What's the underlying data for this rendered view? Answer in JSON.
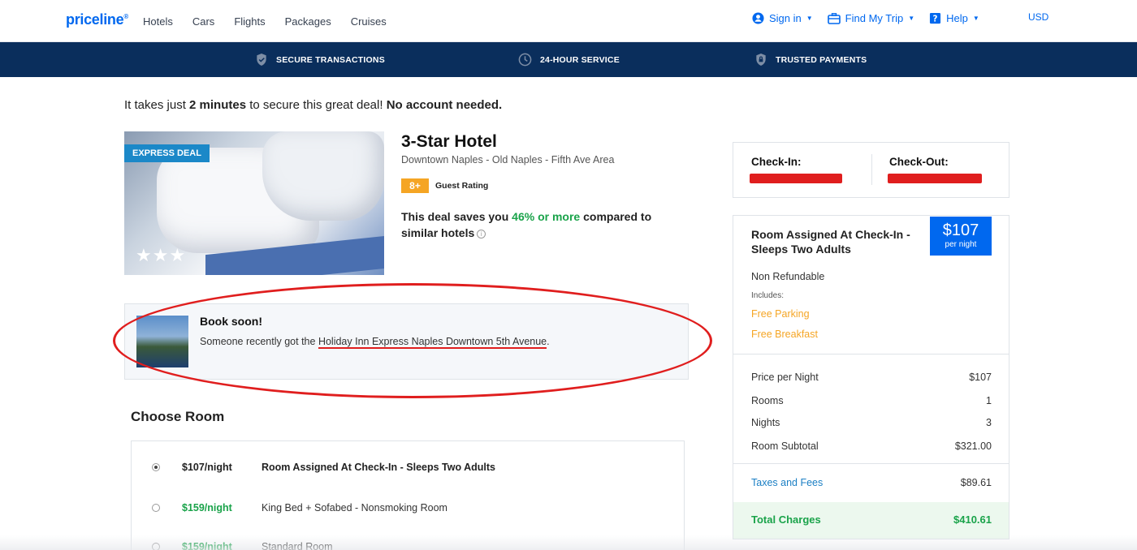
{
  "nav": {
    "logo": "priceline",
    "logo_mark": "®",
    "links": [
      "Hotels",
      "Cars",
      "Flights",
      "Packages",
      "Cruises"
    ],
    "sign_in": "Sign in",
    "find_trip": "Find My Trip",
    "help": "Help",
    "currency": "USD"
  },
  "trust_bar": {
    "items": [
      "SECURE TRANSACTIONS",
      "24-HOUR SERVICE",
      "TRUSTED PAYMENTS"
    ]
  },
  "intro": {
    "part1": "It takes just ",
    "bold1": "2 minutes",
    "part2": " to secure this great deal! ",
    "bold2": "No account needed."
  },
  "hotel": {
    "badge": "EXPRESS DEAL",
    "stars": "★★★",
    "title": "3-Star Hotel",
    "location": "Downtown Naples - Old Naples - Fifth Ave Area",
    "rating_value": "8+",
    "rating_label": "Guest Rating",
    "deal_part1": "This deal saves you ",
    "deal_highlight": "46% or more",
    "deal_part2": " compared to similar hotels",
    "info_glyph": "i"
  },
  "book_soon": {
    "title": "Book soon!",
    "text_before": "Someone recently got the ",
    "hotel_name": "Holiday Inn Express Naples Downtown 5th Avenue",
    "text_after": "."
  },
  "choose_room": {
    "title": "Choose Room",
    "rooms": [
      {
        "price": "$107/night",
        "name": "Room Assigned At Check-In - Sleeps Two Adults",
        "selected": true
      },
      {
        "price": "$159/night",
        "name": "King Bed + Sofabed - Nonsmoking Room",
        "selected": false
      },
      {
        "price": "$159/night",
        "name": "Standard Room",
        "selected": false
      }
    ]
  },
  "check": {
    "in_label": "Check-In:",
    "out_label": "Check-Out:"
  },
  "summary": {
    "room_title": "Room Assigned At Check-In - Sleeps Two Adults",
    "price": "$107",
    "per_night": "per night",
    "refund": "Non Refundable",
    "includes": "Includes:",
    "perks": [
      "Free Parking",
      "Free Breakfast"
    ],
    "lines": [
      {
        "label": "Price per Night",
        "value": "$107"
      },
      {
        "label": "Rooms",
        "value": "1"
      },
      {
        "label": "Nights",
        "value": "3"
      },
      {
        "label": "Room Subtotal",
        "value": "$321.00"
      }
    ],
    "taxes_label": "Taxes and Fees",
    "taxes_value": "$89.61",
    "total_label": "Total Charges",
    "total_value": "$410.61"
  },
  "colors": {
    "brand": "#0068ef",
    "navy": "#0a2e5c",
    "green": "#1aa34a",
    "orange": "#f5a524",
    "annotation_red": "#e01e1e"
  }
}
